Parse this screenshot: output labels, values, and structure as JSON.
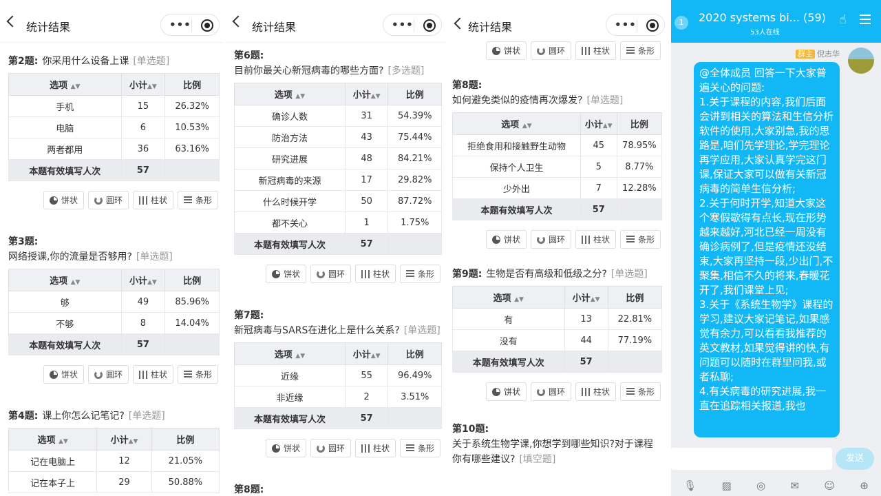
{
  "survey": {
    "header_title": "统计结果",
    "more_glyph": "•••",
    "col_option": "选项",
    "col_count": "小计",
    "col_ratio": "比例",
    "total_label": "本题有效填写人次",
    "btn_pie": "饼状",
    "btn_ring": "圆环",
    "btn_bar": "柱状",
    "btn_strip": "条形"
  },
  "panel1": {
    "questions": [
      {
        "num": "第2题:",
        "text": "你采用什么设备上课",
        "type": "[单选题]",
        "rows": [
          [
            "手机",
            "15",
            "26.32%"
          ],
          [
            "电脑",
            "6",
            "10.53%"
          ],
          [
            "两者都用",
            "36",
            "63.16%"
          ]
        ],
        "total": "57"
      },
      {
        "num": "第3题:",
        "text": "网络授课,你的流量是否够用?",
        "type": "[单选题]",
        "rows": [
          [
            "够",
            "49",
            "85.96%"
          ],
          [
            "不够",
            "8",
            "14.04%"
          ]
        ],
        "total": "57"
      },
      {
        "num": "第4题:",
        "text": "课上你怎么记笔记?",
        "type": "[单选题]",
        "rows": [
          [
            "记在电脑上",
            "12",
            "21.05%"
          ],
          [
            "记在本子上",
            "29",
            "50.88%"
          ]
        ]
      }
    ]
  },
  "panel2": {
    "questions": [
      {
        "num": "第6题:",
        "text": "目前你最关心新冠病毒的哪些方面?",
        "type": "[多选题]",
        "rows": [
          [
            "确诊人数",
            "31",
            "54.39%"
          ],
          [
            "防治方法",
            "43",
            "75.44%"
          ],
          [
            "研究进展",
            "48",
            "84.21%"
          ],
          [
            "新冠病毒的来源",
            "17",
            "29.82%"
          ],
          [
            "什么时候开学",
            "50",
            "87.72%"
          ],
          [
            "都不关心",
            "1",
            "1.75%"
          ]
        ],
        "total": "57"
      },
      {
        "num": "第7题:",
        "text": "新冠病毒与SARS在进化上是什么关系?",
        "type": "[单选题]",
        "rows": [
          [
            "近缘",
            "55",
            "96.49%"
          ],
          [
            "非近缘",
            "2",
            "3.51%"
          ]
        ],
        "total": "57"
      }
    ],
    "next_num": "第8题:"
  },
  "panel3": {
    "questions": [
      {
        "num": "第8题:",
        "text": "如何避免类似的疫情再次爆发?",
        "type": "[单选题]",
        "rows": [
          [
            "拒绝食用和接触野生动物",
            "45",
            "78.95%"
          ],
          [
            "保持个人卫生",
            "5",
            "8.77%"
          ],
          [
            "少外出",
            "7",
            "12.28%"
          ]
        ],
        "total": "57"
      },
      {
        "num": "第9题:",
        "text": "生物是否有高级和低级之分?",
        "type": "[单选题]",
        "rows": [
          [
            "有",
            "13",
            "22.81%"
          ],
          [
            "没有",
            "44",
            "77.19%"
          ]
        ],
        "total": "57"
      }
    ],
    "q10_num": "第10题:",
    "q10_text": "关于系统生物学课,你想学到哪些知识?对于课程你有哪些建议?",
    "q10_type": "[填空题]"
  },
  "chat": {
    "unread": "1",
    "title": "2020 systems bi... (59)",
    "online": "53人在线",
    "sender_role": "群主",
    "sender_name": "倪志华",
    "lines": [
      "@全体成员 回答一下大家普遍关心的问题:",
      "1.关于课程的内容,我们后面会讲到相关的算法和生信分析软件的使用,大家别急,我的思路是,咱们先学理论,学完理论再学应用,大家认真学完这门课,保证大家可以做有关新冠病毒的简单生信分析;",
      "2.关于何时开学,知道大家这个寒假歇得有点长,现在形势越来越好,河北已经一周没有确诊病例了,但是疫情还没结束,大家再坚持一段,少出门,不聚集,相信不久的将来,春暖花开了,我们课堂上见;",
      "3.关于《系统生物学》课程的学习,建议大家记笔记,如果感觉有余力,可以看看我推荐的英文教材,如果觉得讲的快,有问题可以随时在群里问我,或者私聊;",
      "4.有关病毒的研究进展,我一直在追踪相关报道,我也"
    ],
    "send_label": "发送"
  }
}
